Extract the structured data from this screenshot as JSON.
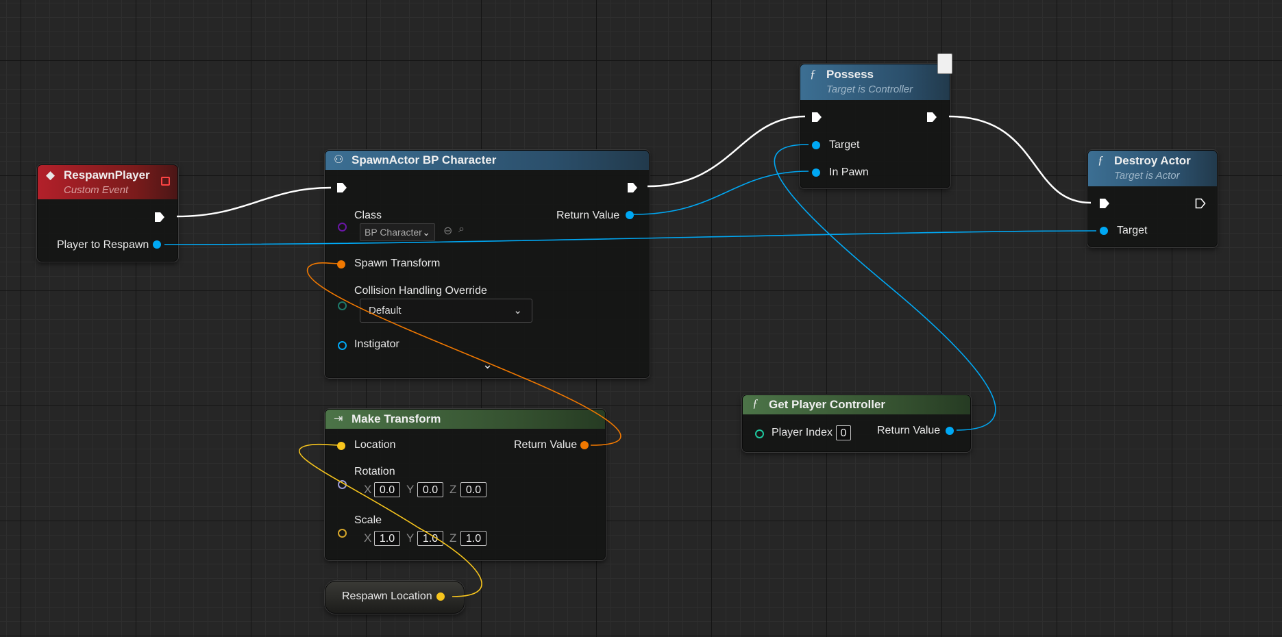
{
  "colors": {
    "exec": "#ffffff",
    "object": "#00a8f4",
    "struct_transform": "#f07800",
    "vector": "#f7c51d",
    "class": "#6a16a6",
    "enum": "#1e7a6a"
  },
  "respawn_player": {
    "title": "RespawnPlayer",
    "subtitle": "Custom Event",
    "icon": "event-diamond-icon",
    "output_label": "Player to Respawn"
  },
  "spawn_actor": {
    "title": "SpawnActor BP Character",
    "icon": "spawn-actor-icon",
    "class_label": "Class",
    "class_value": "BP Character",
    "return_label": "Return Value",
    "spawn_transform_label": "Spawn Transform",
    "collision_label": "Collision Handling Override",
    "collision_value": "Default",
    "instigator_label": "Instigator"
  },
  "possess": {
    "title": "Possess",
    "subtitle": "Target is Controller",
    "icon": "function-icon",
    "target_label": "Target",
    "inpawn_label": "In Pawn"
  },
  "destroy_actor": {
    "title": "Destroy Actor",
    "subtitle": "Target is Actor",
    "icon": "function-icon",
    "target_label": "Target"
  },
  "make_transform": {
    "title": "Make Transform",
    "icon": "make-struct-icon",
    "location_label": "Location",
    "return_label": "Return Value",
    "rotation_label": "Rotation",
    "rotation": {
      "x": "0.0",
      "y": "0.0",
      "z": "0.0"
    },
    "scale_label": "Scale",
    "scale": {
      "x": "1.0",
      "y": "1.0",
      "z": "1.0"
    },
    "axis": {
      "x": "X",
      "y": "Y",
      "z": "Z"
    }
  },
  "get_player_controller": {
    "title": "Get Player Controller",
    "icon": "function-icon",
    "player_index_label": "Player Index",
    "player_index_value": "0",
    "return_label": "Return Value"
  },
  "respawn_location": {
    "label": "Respawn Location"
  }
}
